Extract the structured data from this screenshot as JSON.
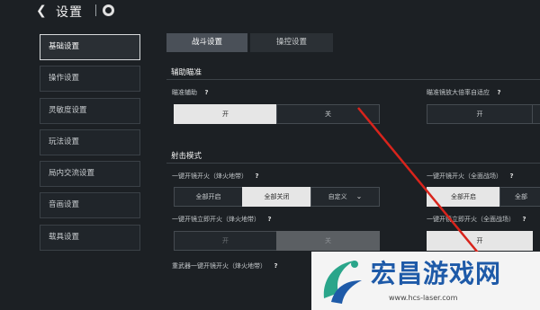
{
  "header": {
    "title": "设置"
  },
  "nav": {
    "items": [
      {
        "label": "基础设置",
        "active": true
      },
      {
        "label": "操作设置",
        "active": false
      },
      {
        "label": "灵敏度设置",
        "active": false
      },
      {
        "label": "玩法设置",
        "active": false
      },
      {
        "label": "局内交流设置",
        "active": false
      },
      {
        "label": "音画设置",
        "active": false
      },
      {
        "label": "载具设置",
        "active": false
      }
    ]
  },
  "tabs": [
    {
      "label": "战斗设置",
      "active": true
    },
    {
      "label": "操控设置",
      "active": false
    }
  ],
  "aim": {
    "section_title": "辅助瞄准",
    "assist_label": "瞄准辅助",
    "assist_on": "开",
    "assist_off": "关",
    "scope_label": "瞄准镜放大倍率自适应",
    "scope_on": "开"
  },
  "fire": {
    "section_title": "射击模式",
    "one_key_label": "一键开镜开火（烽火地带）",
    "one_key_opts": [
      "全部开启",
      "全部关闭",
      "自定义"
    ],
    "one_key_full_label": "一键开镜开火（全面战场）",
    "one_key_full_opts": [
      "全部开启",
      "全部"
    ],
    "instant_label": "一键开镜立即开火（烽火地带）",
    "instant_on": "开",
    "instant_off": "关",
    "instant_full_label": "一键开镜立即开火（全面战场）",
    "instant_full_on": "开",
    "heavy_label": "重武器一键开镜开火（烽火地带）"
  },
  "help_mark": "?",
  "watermark": {
    "text": "宏昌游戏网",
    "url": "www.hcs-laser.com"
  }
}
